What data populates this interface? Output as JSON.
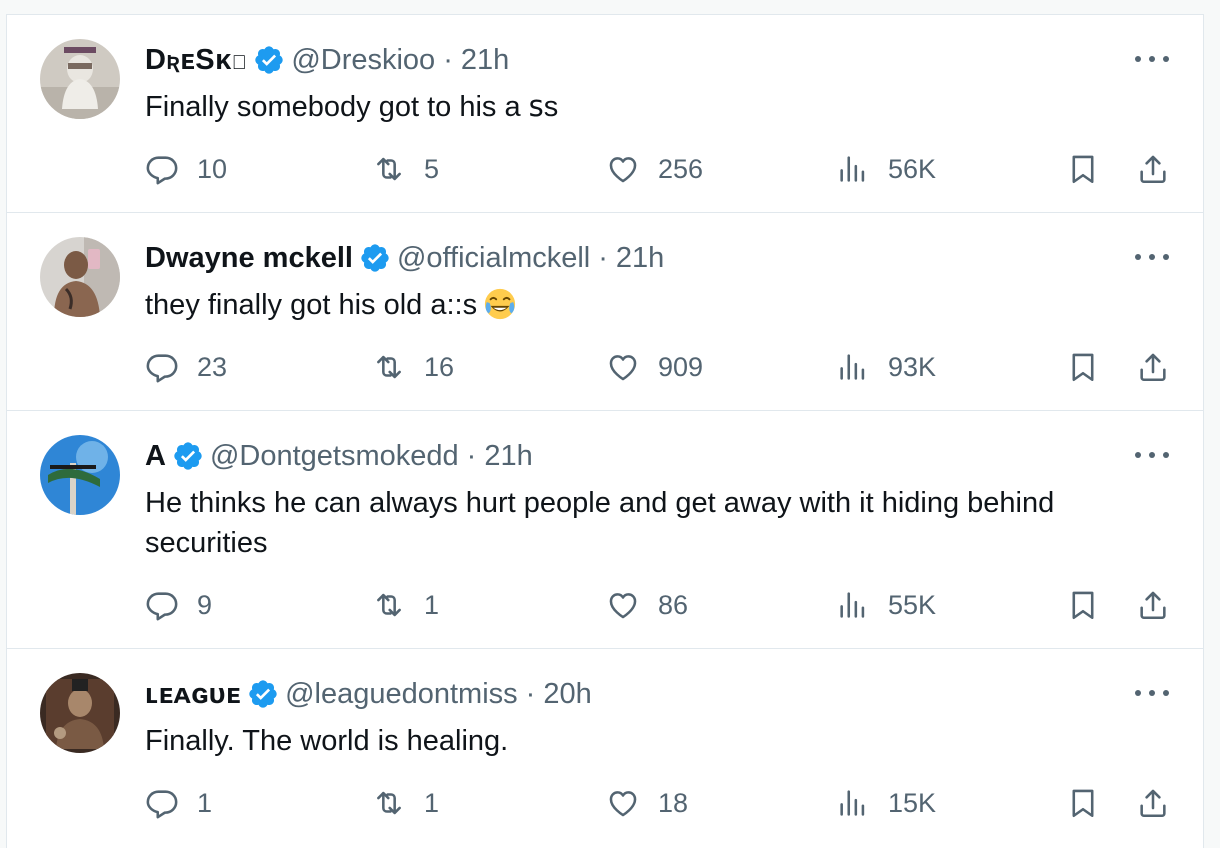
{
  "colors": {
    "verified_badge": "#1d9bf0",
    "secondary_text": "#536471",
    "primary_text": "#0f1419",
    "divider": "#e1e8ed"
  },
  "replies": [
    {
      "name": "DʀᴇSᴋɪ",
      "handle": "@Dreskioo",
      "separator": "·",
      "time": "21h",
      "text": "Finally somebody got to his a ꜱs",
      "emoji": "",
      "counts": {
        "reply": "10",
        "retweet": "5",
        "like": "256",
        "views": "56K"
      }
    },
    {
      "name": "Dwayne mckell",
      "handle": "@officialmckell",
      "separator": "·",
      "time": "21h",
      "text": "they finally got his old a::s",
      "emoji": "face-with-tears-of-joy-icon",
      "counts": {
        "reply": "23",
        "retweet": "16",
        "like": "909",
        "views": "93K"
      }
    },
    {
      "name": "A",
      "handle": "@Dontgetsmokedd",
      "separator": "·",
      "time": "21h",
      "text": "He thinks he can always hurt people and get away with it hiding behind securities",
      "emoji": "",
      "counts": {
        "reply": "9",
        "retweet": "1",
        "like": "86",
        "views": "55K"
      }
    },
    {
      "name": "ʟᴇᴀɢᴜᴇ",
      "handle": "@leaguedontmiss",
      "separator": "·",
      "time": "20h",
      "text": "Finally. The world is healing.",
      "emoji": "",
      "counts": {
        "reply": "1",
        "retweet": "1",
        "like": "18",
        "views": "15K"
      }
    }
  ]
}
